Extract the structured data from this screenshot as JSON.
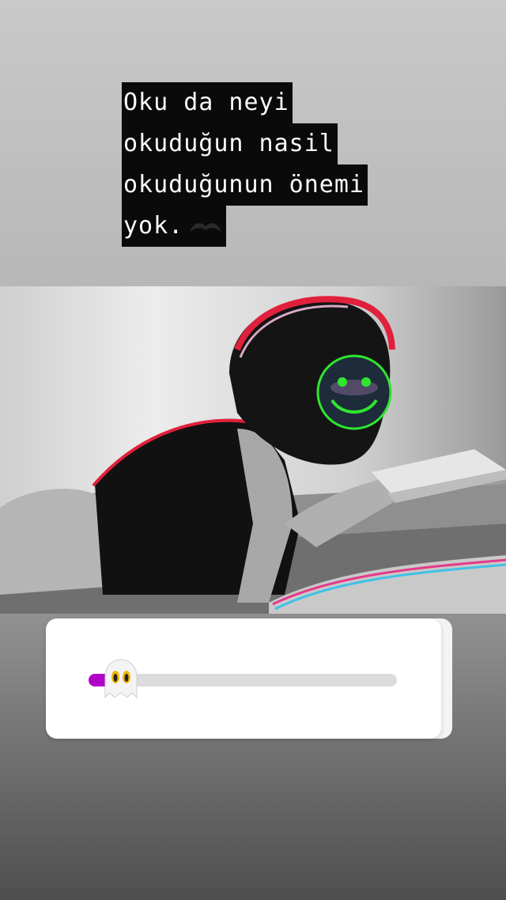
{
  "story": {
    "caption_lines": [
      "Oku da neyi",
      "okuduğun nasil",
      "okuduğunun önemi",
      "yok."
    ],
    "caption_emoji": "🖤"
  },
  "slider": {
    "emoji": "👻",
    "value_fraction": 0.08,
    "fill_color": "#b100c8",
    "track_color": "#dcdcdc"
  },
  "photo": {
    "sticker": "smiley-face-icon",
    "sticker_color": "#2ee62e"
  }
}
